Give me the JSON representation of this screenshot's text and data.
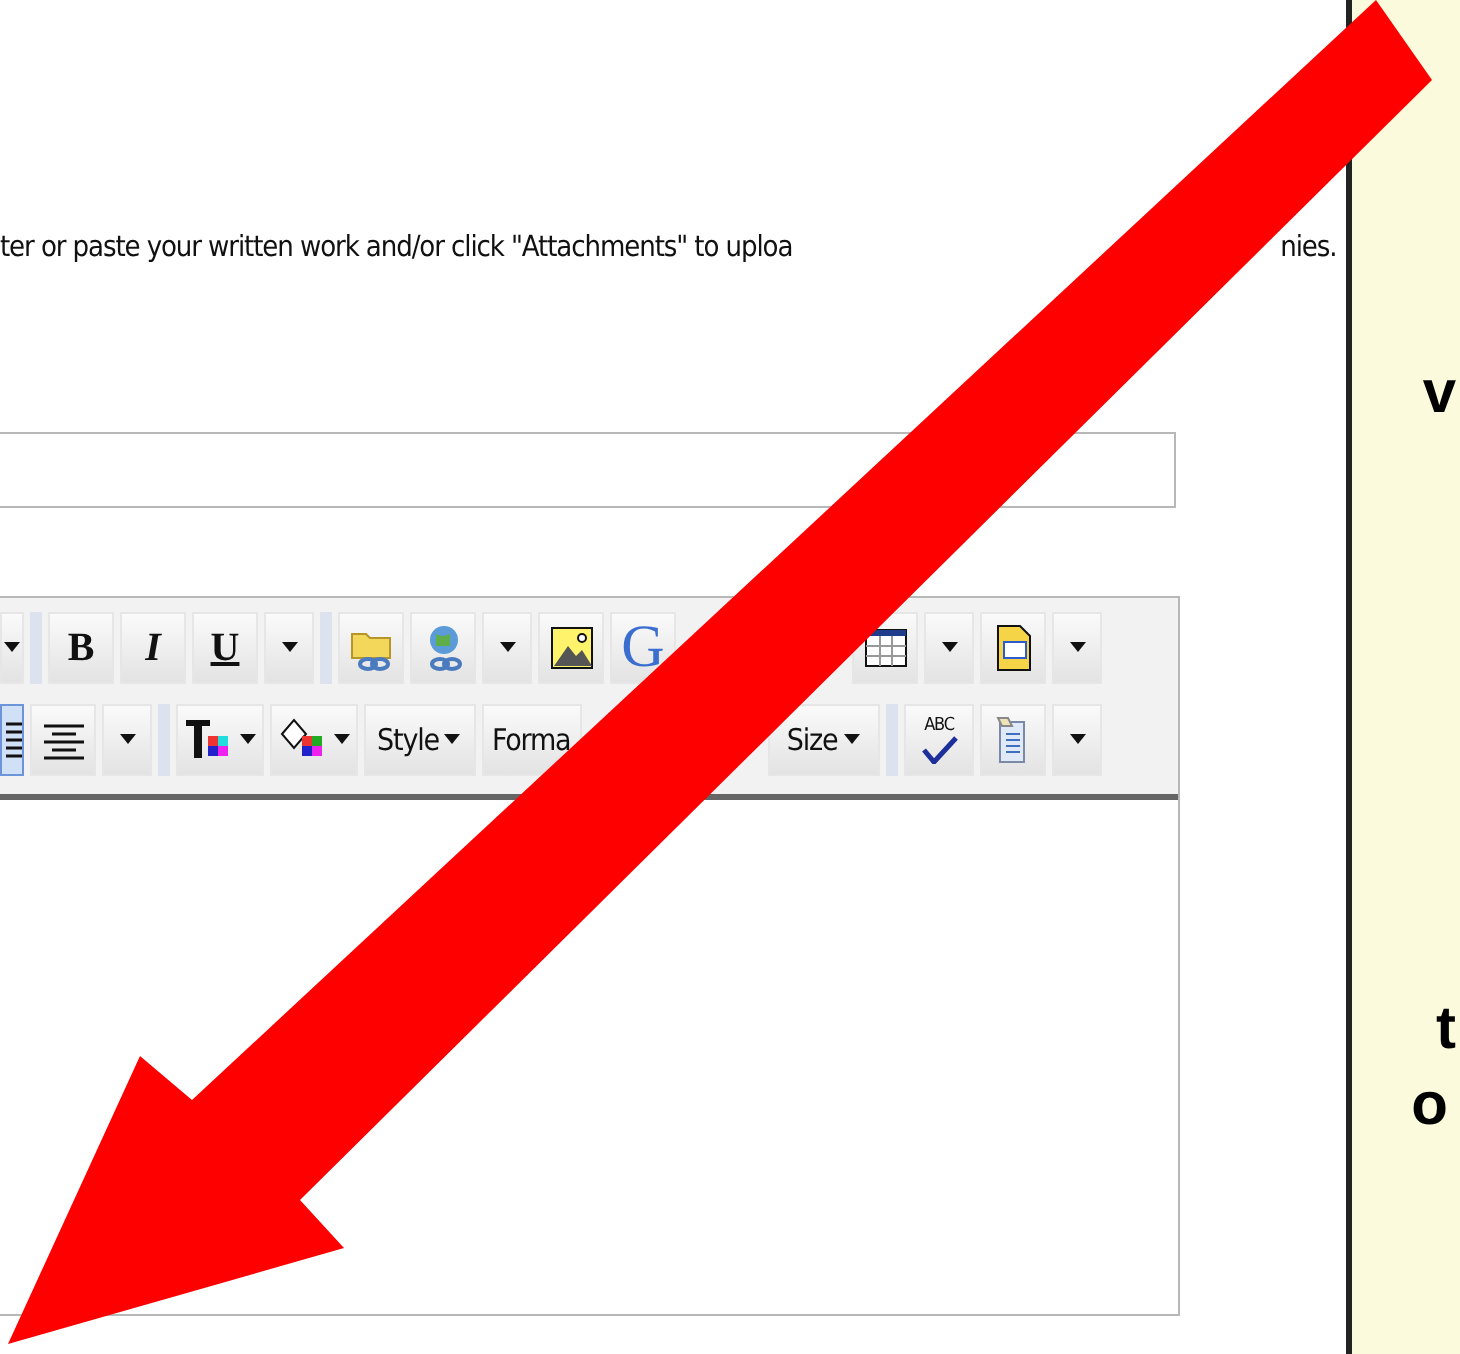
{
  "instructions": {
    "text": "ter or paste your written work and/or click \"Attachments\" to uploa",
    "tail": "nies."
  },
  "title_field": {
    "kind": "text-input"
  },
  "editor": {
    "toolbar_rows": [
      [
        {
          "kind": "edge-caret"
        },
        {
          "kind": "sep"
        },
        {
          "kind": "bold",
          "label": "B"
        },
        {
          "kind": "italic",
          "label": "I"
        },
        {
          "kind": "underline",
          "label": "U"
        },
        {
          "kind": "caret"
        },
        {
          "kind": "sep"
        },
        {
          "kind": "folder-link"
        },
        {
          "kind": "globe-link"
        },
        {
          "kind": "caret"
        },
        {
          "kind": "image"
        },
        {
          "kind": "google",
          "label": "G"
        },
        {
          "kind": "gap"
        },
        {
          "kind": "table"
        },
        {
          "kind": "caret"
        },
        {
          "kind": "document"
        },
        {
          "kind": "caret"
        }
      ],
      [
        {
          "kind": "edge-align-justify",
          "selected": true
        },
        {
          "kind": "align-center",
          "selected": false
        },
        {
          "kind": "caret"
        },
        {
          "kind": "sep"
        },
        {
          "kind": "text-color"
        },
        {
          "kind": "fill-color"
        },
        {
          "kind": "menu",
          "label": "Style"
        },
        {
          "kind": "cut-menu",
          "label": "Forma"
        },
        {
          "kind": "gap"
        },
        {
          "kind": "menu",
          "label": "Size"
        },
        {
          "kind": "sep"
        },
        {
          "kind": "spellcheck",
          "label": "ABC"
        },
        {
          "kind": "paste"
        },
        {
          "kind": "caret"
        }
      ]
    ]
  },
  "callout": {
    "letters": [
      "v",
      "t",
      "o"
    ]
  }
}
